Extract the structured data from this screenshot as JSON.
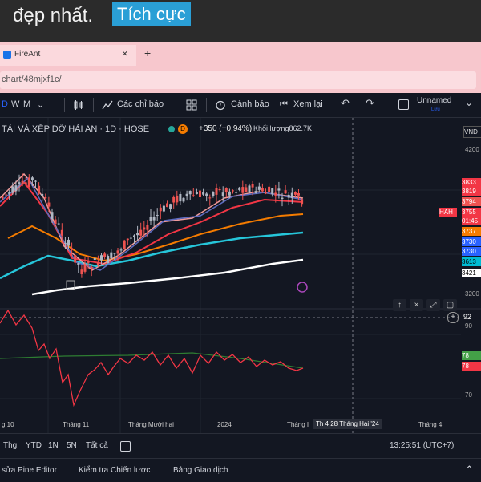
{
  "caption": {
    "text": "đẹp nhất.",
    "badge": "Tích cực"
  },
  "browser": {
    "tab_title": "FireAnt",
    "tab_close": "×",
    "new_tab": "+",
    "url": "chart/48mjxf1c/"
  },
  "toolbar": {
    "intervals": [
      "D",
      "W",
      "M"
    ],
    "indicators_label": "Các chỉ báo",
    "alert_label": "Cảnh báo",
    "replay_label": "Xem lại",
    "layout_name": "Unnamed",
    "layout_sub": "Lưu"
  },
  "legend": {
    "symbol_text": "TẢI VÀ XẾP DỠ HẢI AN · 1D · HOSE",
    "dot_label": "D",
    "change": "+350 (+0.94%)",
    "volume_label": "Khối lượng",
    "volume_value": "862.7K"
  },
  "price_axis": {
    "symbol": "VND",
    "ticks": [
      "4200",
      "3200",
      "90",
      "70"
    ],
    "rsi_value": "92",
    "labels": [
      {
        "text": "3833",
        "color": "#f23645"
      },
      {
        "text": "3819",
        "color": "#f23645"
      },
      {
        "text": "3794",
        "color": "#ef5350"
      },
      {
        "text": "3755",
        "color": "#f23645"
      },
      {
        "text": "01:45",
        "color": "#f23645"
      },
      {
        "text": "3737",
        "color": "#f57c00"
      },
      {
        "text": "3730",
        "color": "#2962ff"
      },
      {
        "text": "3730",
        "color": "#2962ff"
      },
      {
        "text": "3613",
        "color": "#00bcd4"
      },
      {
        "text": "3421",
        "color": "#ffffff"
      },
      {
        "text": "78",
        "color": "#43a047"
      },
      {
        "text": "78",
        "color": "#f23645"
      }
    ],
    "ticker_tag": "HAH"
  },
  "time_axis": {
    "labels": [
      "g 10",
      "Tháng 11",
      "Tháng Mười hai",
      "2024",
      "Tháng I"
    ],
    "cursor_label": "Th 4 28 Tháng Hai '24",
    "end_label": "Tháng 4"
  },
  "chart_controls": [
    "↑",
    "×",
    "⤢",
    "▢"
  ],
  "bottom_bar": {
    "ranges": [
      "Thg",
      "YTD",
      "1N",
      "5N",
      "Tất cả"
    ],
    "time": "13:25:51 (UTC+7)"
  },
  "footer": {
    "items": [
      "sửa Pine Editor",
      "Kiểm tra Chiến lược",
      "Bảng Giao dịch"
    ]
  },
  "chart_data": {
    "type": "candlestick",
    "symbol_line": "TẢI VÀ XẾP DỠ HẢI AN · 1D · HOSE",
    "x_labels": [
      "g 10",
      "Tháng 11",
      "Tháng Mười hai",
      "2024",
      "Tháng I"
    ],
    "price_ticks": [
      4200,
      3200
    ],
    "price_label_values": [
      3833,
      3819,
      3794,
      3755,
      3737,
      3730,
      3730,
      3613,
      3421
    ],
    "rsi_ticks": [
      90,
      70
    ],
    "rsi_values": [
      78,
      78
    ],
    "rsi_current": 92,
    "grid": true
  }
}
